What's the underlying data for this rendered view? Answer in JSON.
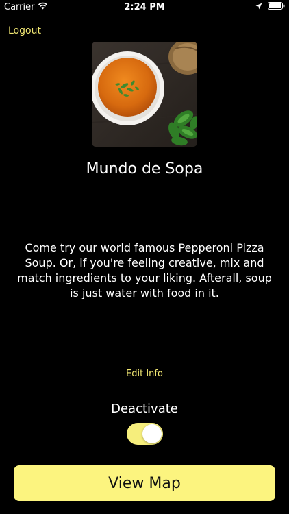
{
  "status_bar": {
    "carrier": "Carrier",
    "time": "2:24 PM",
    "wifi_icon": "wifi-icon",
    "location_icon": "location-arrow-icon",
    "battery_icon": "battery-icon"
  },
  "nav": {
    "logout_label": "Logout"
  },
  "restaurant": {
    "image_description": "tomato soup bowl photo",
    "name": "Mundo de Sopa",
    "description": "Come try our world famous Pepperoni Pizza Soup. Or, if you're feeling creative, mix and match ingredients to your liking. Afterall, soup is just water with food in it."
  },
  "actions": {
    "edit_info_label": "Edit Info",
    "deactivate_label": "Deactivate",
    "deactivate_on": true,
    "view_map_label": "View Map"
  },
  "colors": {
    "background": "#000000",
    "accent": "#f2e873",
    "button_fill": "#fcf47f",
    "toggle_on": "#f6ee7c"
  }
}
